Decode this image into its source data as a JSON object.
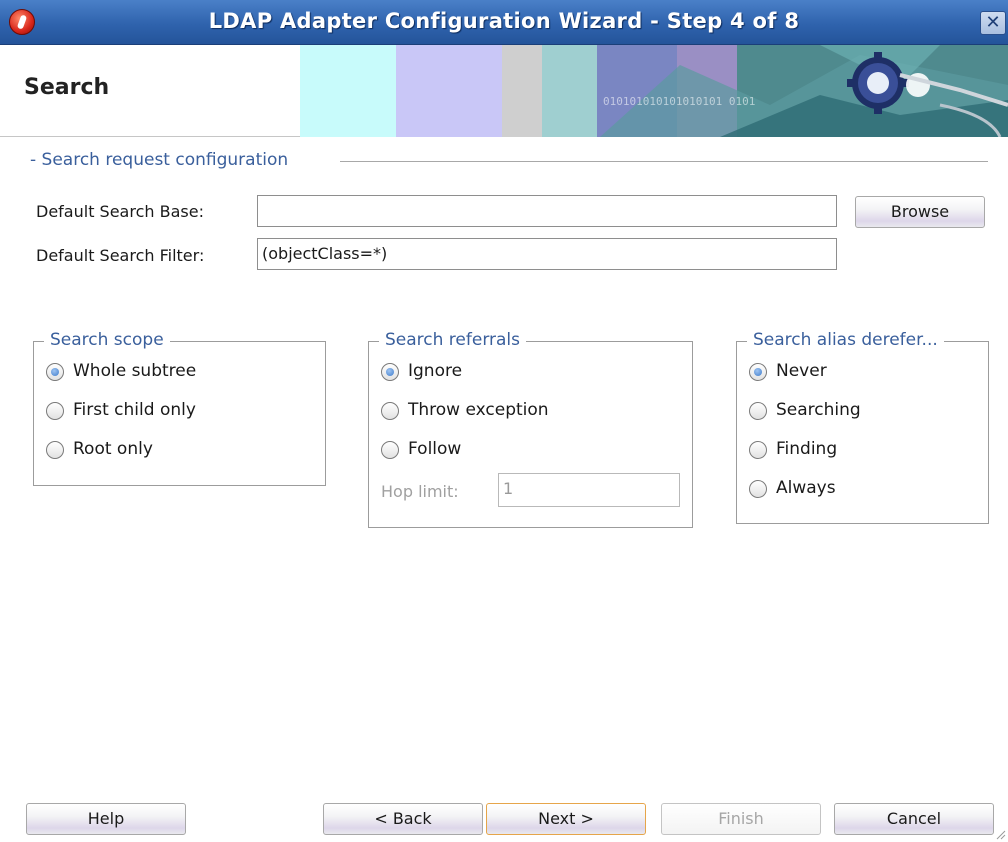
{
  "window": {
    "title": "LDAP Adapter Configuration Wizard - Step 4 of 8",
    "close_glyph": "✕"
  },
  "banner": {
    "title": "Search",
    "binary_text": "010101010101010101 0101"
  },
  "section": {
    "legend": "- Search request configuration"
  },
  "fields": {
    "search_base": {
      "label": "Default Search Base:",
      "value": ""
    },
    "search_filter": {
      "label": "Default Search Filter:",
      "value": "(objectClass=*)"
    },
    "browse_label": "Browse"
  },
  "scope": {
    "title": "Search scope",
    "options": [
      {
        "label": "Whole subtree",
        "checked": true
      },
      {
        "label": "First child only",
        "checked": false
      },
      {
        "label": "Root only",
        "checked": false
      }
    ]
  },
  "referrals": {
    "title": "Search referrals",
    "options": [
      {
        "label": "Ignore",
        "checked": true
      },
      {
        "label": "Throw exception",
        "checked": false
      },
      {
        "label": "Follow",
        "checked": false
      }
    ],
    "hop_label": "Hop limit:",
    "hop_value": "1"
  },
  "alias": {
    "title": "Search alias derefer...",
    "options": [
      {
        "label": "Never",
        "checked": true
      },
      {
        "label": "Searching",
        "checked": false
      },
      {
        "label": "Finding",
        "checked": false
      },
      {
        "label": "Always",
        "checked": false
      }
    ]
  },
  "buttons": {
    "help": "Help",
    "back": "< Back",
    "next": "Next >",
    "finish": "Finish",
    "cancel": "Cancel"
  },
  "colors": {
    "titlebar": "#2f63ad",
    "group_title": "#3a5f9c",
    "default_button_border": "#e6a54a"
  }
}
